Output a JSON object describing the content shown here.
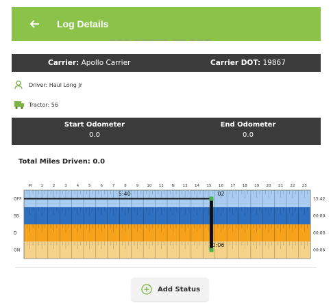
{
  "header": {
    "title": "Log Details",
    "back_icon": "arrow-left-icon",
    "color": "#8bc34a"
  },
  "carrier": {
    "label": "Carrier:",
    "value": "Apollo Carrier",
    "dot_label": "Carrier DOT:",
    "dot_value": "19867"
  },
  "driver": {
    "label": "Driver:",
    "value": "Haul Long Jr",
    "icon": "person-icon"
  },
  "tractor": {
    "label": "Tractor:",
    "value": "56",
    "icon": "truck-icon"
  },
  "odometer": {
    "start_label": "Start Odometer",
    "start_value": "0.0",
    "end_label": "End Odometer",
    "end_value": "0.0"
  },
  "total_miles": {
    "label": "Total Miles Driven:",
    "value": "0.0"
  },
  "chart_data": {
    "type": "table",
    "hours": [
      "M",
      "1",
      "2",
      "3",
      "4",
      "5",
      "6",
      "7",
      "8",
      "9",
      "10",
      "11",
      "N",
      "13",
      "14",
      "15",
      "16",
      "17",
      "18",
      "19",
      "20",
      "21",
      "22",
      "23"
    ],
    "rows": [
      {
        "status": "OFF",
        "total": "15:42",
        "color": "#a9cdf0"
      },
      {
        "status": "SB",
        "total": "00:00",
        "color": "#2f6fc0"
      },
      {
        "status": "D",
        "total": "00:00",
        "color": "#f6a21c"
      },
      {
        "status": "ON",
        "total": "00:06",
        "color": "#f5d38a"
      }
    ],
    "segments": [
      {
        "status": "OFF",
        "start_hour": 0,
        "end_hour": 15.7
      },
      {
        "status": "ON",
        "start_hour": 15.7,
        "end_hour": 15.8
      }
    ],
    "annotations": [
      "5:40",
      "02",
      "0:06"
    ]
  },
  "actions": {
    "add_status": "Add Status",
    "add_icon": "plus-circle-icon"
  }
}
